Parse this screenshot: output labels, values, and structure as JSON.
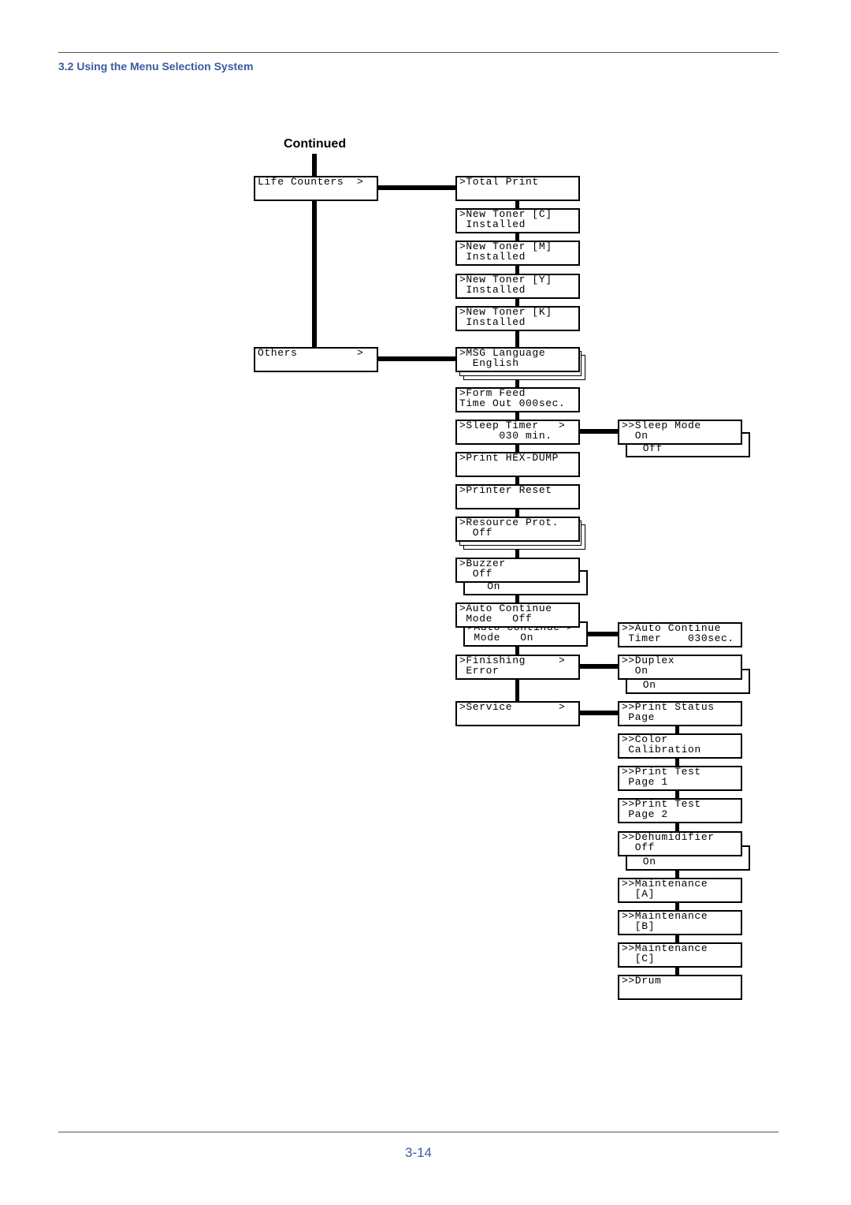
{
  "header": {
    "section": "3.2 Using the Menu Selection System"
  },
  "diagram": {
    "continued_label": "Continued",
    "left": [
      {
        "id": "life",
        "lines": [
          "Life Counters  >"
        ]
      },
      {
        "id": "others",
        "lines": [
          "Others         >"
        ]
      }
    ],
    "middle": [
      {
        "id": "total",
        "lines": [
          ">Total Print"
        ]
      },
      {
        "id": "tc",
        "lines": [
          ">New Toner [C]",
          " Installed"
        ]
      },
      {
        "id": "tm",
        "lines": [
          ">New Toner [M]",
          " Installed"
        ]
      },
      {
        "id": "ty",
        "lines": [
          ">New Toner [Y]",
          " Installed"
        ]
      },
      {
        "id": "tk",
        "lines": [
          ">New Toner [K]",
          " Installed"
        ]
      },
      {
        "id": "msg",
        "lines": [
          ">MSG Language",
          "  English"
        ]
      },
      {
        "id": "ff",
        "lines": [
          ">Form Feed",
          "Time Out 000sec."
        ]
      },
      {
        "id": "sleep",
        "lines": [
          ">Sleep Timer   >",
          "      030 min."
        ]
      },
      {
        "id": "hex",
        "lines": [
          ">Print HEX-DUMP"
        ]
      },
      {
        "id": "reset",
        "lines": [
          ">Printer Reset"
        ]
      },
      {
        "id": "res",
        "lines": [
          ">Resource Prot.",
          "  Off"
        ]
      },
      {
        "id": "buzz",
        "lines": [
          ">Buzzer",
          "  Off"
        ]
      },
      {
        "id": "auto",
        "lines": [
          ">Auto Continue",
          " Mode   Off"
        ]
      },
      {
        "id": "fin",
        "lines": [
          ">Finishing     >",
          " Error"
        ]
      },
      {
        "id": "svc",
        "lines": [
          ">Service       >"
        ]
      }
    ],
    "middle_alt": [
      {
        "id": "buzz2",
        "lines": [
          "",
          "",
          "   On"
        ]
      },
      {
        "id": "auto2",
        "lines": [
          ">Auto Continue >",
          " Mode   On"
        ]
      }
    ],
    "right": [
      {
        "id": "sm",
        "lines": [
          ">>Sleep Mode",
          "  On"
        ]
      },
      {
        "id": "act",
        "lines": [
          ">>Auto Continue",
          " Timer    030sec."
        ]
      },
      {
        "id": "dup",
        "lines": [
          ">>Duplex",
          "  On"
        ]
      },
      {
        "id": "ps",
        "lines": [
          ">>Print Status",
          " Page"
        ]
      },
      {
        "id": "cc",
        "lines": [
          ">>Color",
          " Calibration"
        ]
      },
      {
        "id": "pt1",
        "lines": [
          ">>Print Test",
          " Page 1"
        ]
      },
      {
        "id": "pt2",
        "lines": [
          ">>Print Test",
          " Page 2"
        ]
      },
      {
        "id": "dh",
        "lines": [
          ">>Dehumidifier",
          "  Off"
        ]
      },
      {
        "id": "ma",
        "lines": [
          ">>Maintenance",
          "  [A]"
        ]
      },
      {
        "id": "mb",
        "lines": [
          ">>Maintenance",
          "  [B]"
        ]
      },
      {
        "id": "mc",
        "lines": [
          ">>Maintenance",
          "  [C]"
        ]
      },
      {
        "id": "drum",
        "lines": [
          ">>Drum"
        ]
      }
    ],
    "right_alt": [
      {
        "id": "sm2",
        "lines": [
          "",
          "  Off"
        ]
      },
      {
        "id": "dup2",
        "lines": [
          "",
          "  On"
        ]
      },
      {
        "id": "dh2",
        "lines": [
          "",
          "  On"
        ]
      }
    ]
  },
  "footer": {
    "page_number": "3-14"
  }
}
